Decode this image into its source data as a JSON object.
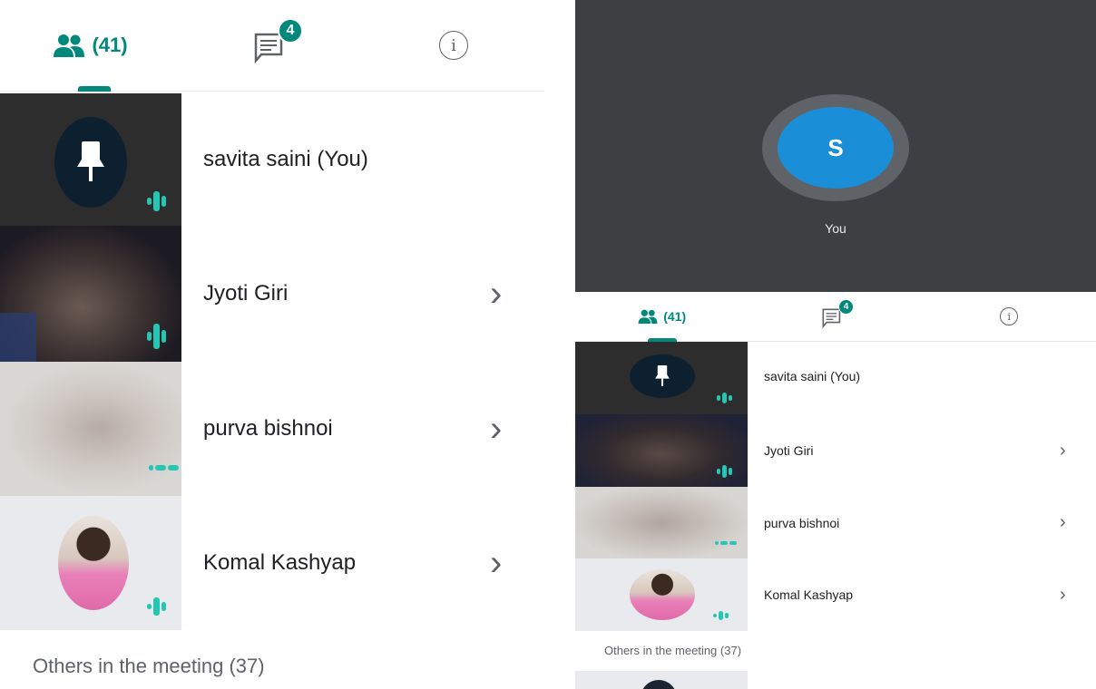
{
  "tabs": {
    "people_count": "(41)",
    "chat_badge": "4",
    "info_glyph": "i"
  },
  "participants": [
    {
      "name": "savita saini (You)",
      "chevron": ""
    },
    {
      "name": "Jyoti Giri",
      "chevron": "›"
    },
    {
      "name": "purva bishnoi",
      "chevron": "›"
    },
    {
      "name": "Komal Kashyap",
      "chevron": "›"
    }
  ],
  "others_section": "Others in the meeting (37)",
  "self_view": {
    "avatar_letter": "S",
    "label": "You"
  },
  "colors": {
    "accent": "#00897b",
    "audio": "#26c6b4",
    "avatar": "#1a8fd8",
    "video_bg": "#3c4043"
  }
}
